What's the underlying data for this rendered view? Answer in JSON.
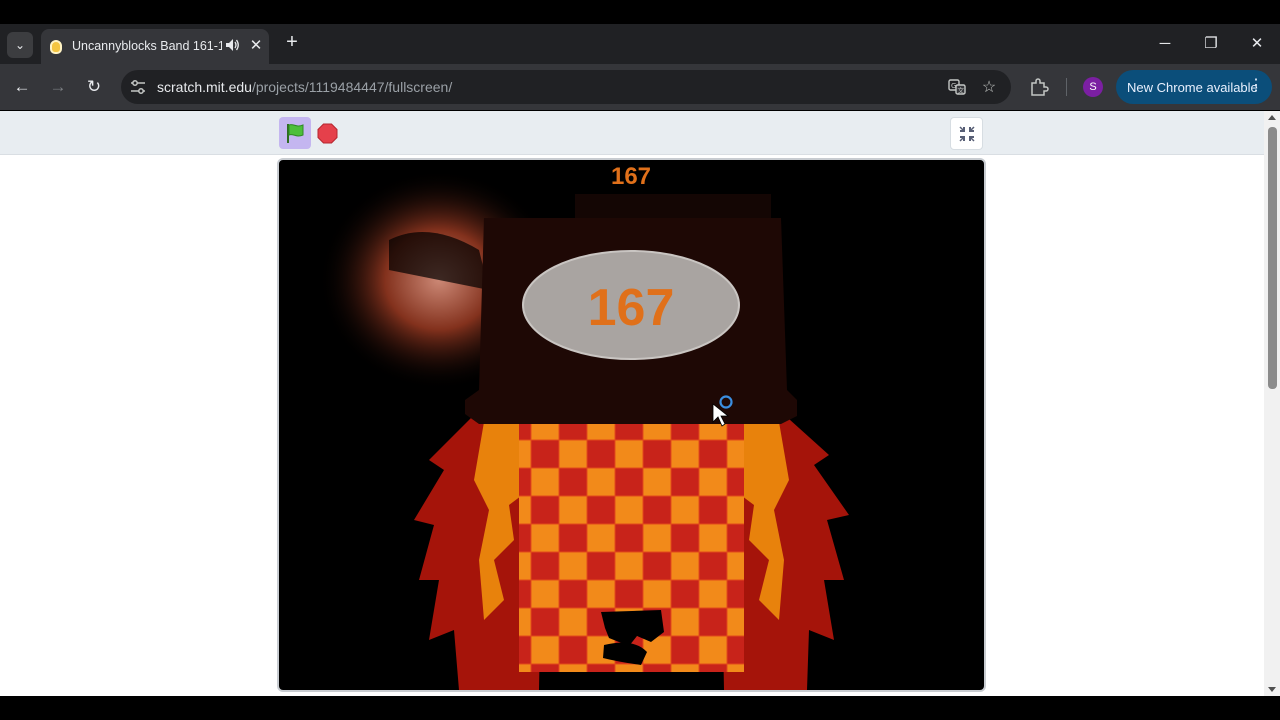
{
  "browser": {
    "tab": {
      "title": "Uncannyblocks Band 161-1",
      "close_glyph": "✕"
    },
    "new_tab_glyph": "+",
    "window_controls": {
      "minimize": "─",
      "restore": "❐",
      "close": "✕"
    },
    "nav": {
      "back": "←",
      "forward": "→",
      "reload": "↻"
    },
    "address": {
      "host": "scratch.mit.edu",
      "path": "/projects/1119484447/fullscreen/"
    },
    "bookmark_glyph": "☆",
    "profile_initial": "S",
    "update_button": {
      "label": "New Chrome available",
      "menu_glyph": "⋮"
    }
  },
  "project": {
    "counter": "167",
    "face_number": "167"
  },
  "colors": {
    "stage_bg": "#000000",
    "accent_orange": "#e0701a",
    "flame_red": "#a5140a",
    "flame_orange": "#e8820c",
    "checker_red": "#c8231a",
    "checker_orange": "#f28a1a",
    "face_oval": "#a9a4a1",
    "body_dark": "#1e0805",
    "update_button_bg": "#0b4e7a"
  },
  "icons": {
    "tab_search": "chevron-down-icon",
    "favicon": "scratch-favicon-icon",
    "audio": "speaker-icon",
    "site_info": "tune-icon",
    "translate": "translate-icon",
    "bookmark": "star-icon",
    "extensions": "puzzle-icon",
    "green_flag": "green-flag-icon",
    "stop": "stop-sign-icon",
    "unfullscreen": "exit-fullscreen-icon"
  }
}
